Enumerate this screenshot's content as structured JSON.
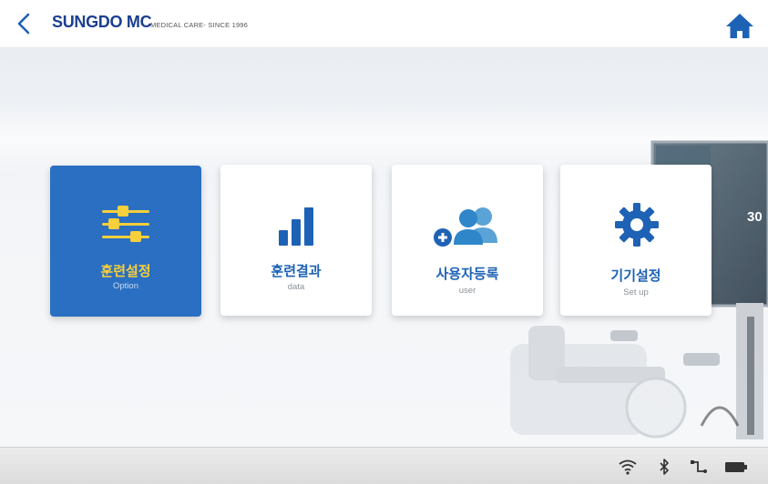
{
  "header": {
    "brand": "SUNGDO MC",
    "tagline": "MEDICAL CARE- SINCE 1996",
    "back_icon": "chevron-left-icon",
    "home_icon": "home-icon"
  },
  "menu": [
    {
      "title": "훈련설정",
      "subtitle": "Option",
      "icon": "sliders-icon",
      "selected": true
    },
    {
      "title": "훈련결과",
      "subtitle": "data",
      "icon": "bar-chart-icon",
      "selected": false
    },
    {
      "title": "사용자등록",
      "subtitle": "user",
      "icon": "add-user-icon",
      "selected": false
    },
    {
      "title": "기기설정",
      "subtitle": "Set up",
      "icon": "gear-icon",
      "selected": false
    }
  ],
  "background_screen": {
    "label": "30"
  },
  "status": {
    "icons": [
      "wifi-icon",
      "bluetooth-icon",
      "usb-icon",
      "battery-icon"
    ]
  },
  "colors": {
    "brand": "#1b3f8f",
    "accent": "#2a6fc2",
    "selected_title": "#f6cf3c",
    "icon_blue": "#1e62b5"
  }
}
